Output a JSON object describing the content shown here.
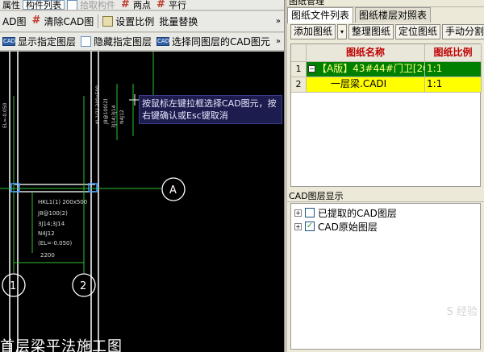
{
  "toolbar1": {
    "attr_label": "属性",
    "component_list_label": "构件列表",
    "pick_label": "拾取构件",
    "two_points_label": "两点",
    "parallel_label": "平行"
  },
  "toolbar2": {
    "cad_layer_label": "AD图",
    "clear_cad_label": "清除CAD图",
    "set_scale_label": "设置比例",
    "batch_replace_label": "批量替换",
    "more_label": "»"
  },
  "toolbar3": {
    "show_layer_label": "显示指定图层",
    "hide_layer_label": "隐藏指定图层",
    "select_same_layer_label": "选择同图层的CAD图元",
    "more_label": "»"
  },
  "cad": {
    "tooltip": "按鼠标左键拉框选择CAD图元，按右键确认或Esc键取消",
    "axis_a": "A",
    "axis_1": "1",
    "axis_2": "2",
    "beam_label_lines": [
      "HKL1(1) 200x500",
      "J8@100(2)",
      "3J14;3J14",
      "N4J12",
      "(EL=-0.050)"
    ],
    "dimension": "2200",
    "drawing_title": "首层梁平法施工图",
    "vertical_labels": [
      "KL1(1) 200x500",
      "J8@100(2)",
      "3J14;3J14",
      "N4J12",
      "EL=-0.050"
    ]
  },
  "right_panel": {
    "title": "图纸管理",
    "tabs": [
      {
        "label": "图纸文件列表",
        "active": true
      },
      {
        "label": "图纸楼层对照表",
        "active": false
      }
    ],
    "buttons": {
      "add": "添加图纸",
      "add_dropdown": "▾",
      "organize": "整理图纸",
      "locate": "定位图纸",
      "manual_split": "手动分割"
    },
    "grid": {
      "headers": [
        "",
        "图纸名称",
        "图纸比例"
      ],
      "rows": [
        {
          "index": "1",
          "name": "【A版】43#44#门卫[201",
          "scale": "1:1",
          "expanded": true
        },
        {
          "index": "2",
          "name": "一层梁.CADI",
          "scale": "1:1"
        }
      ]
    },
    "layer_panel": {
      "title": "CAD图层显示",
      "items": [
        {
          "label": "已提取的CAD图层",
          "checked": false
        },
        {
          "label": "CAD原始图层",
          "checked": true
        }
      ]
    },
    "watermark": "S 经验"
  }
}
